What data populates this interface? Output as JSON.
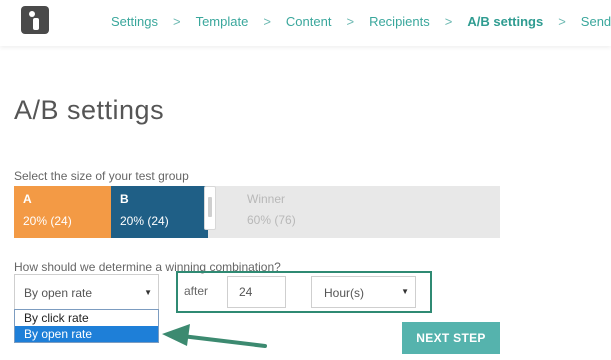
{
  "nav": {
    "items": [
      {
        "label": "Settings",
        "active": false
      },
      {
        "label": "Template",
        "active": false
      },
      {
        "label": "Content",
        "active": false
      },
      {
        "label": "Recipients",
        "active": false
      },
      {
        "label": "A/B settings",
        "active": true
      },
      {
        "label": "Send",
        "active": false
      }
    ],
    "separator": ">"
  },
  "page": {
    "title": "A/B settings"
  },
  "test_group": {
    "label": "Select the size of your test group",
    "a": {
      "name": "A",
      "value": "20%  (24)",
      "percent": 20
    },
    "b": {
      "name": "B",
      "value": "20%  (24)",
      "percent": 20
    },
    "winner": {
      "name": "Winner",
      "value": "60%  (76)",
      "percent": 60
    }
  },
  "winning": {
    "label": "How should we determine a winning combination?",
    "criteria_value": "By open rate",
    "after_label": "after",
    "hours_value": "24",
    "unit_value": "Hour(s)",
    "options": [
      "By click rate",
      "By open rate"
    ],
    "selected_option": "By open rate"
  },
  "actions": {
    "next_label": "NEXT STEP"
  },
  "colors": {
    "accent": "#3aa79c",
    "group_a": "#f39a45",
    "group_b": "#1f5f86",
    "winner_bg": "#e8e8e8",
    "highlight": "#2f8a73",
    "button": "#55b3ad",
    "dropdown_selected": "#1e7fd8"
  }
}
